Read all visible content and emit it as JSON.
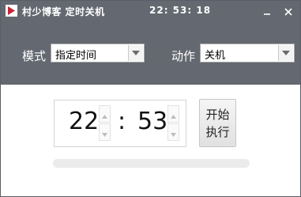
{
  "titlebar": {
    "title": "村少博客 定时关机",
    "clock": "22: 53: 18"
  },
  "options": {
    "mode_label": "模式",
    "mode_value": "指定时间",
    "action_label": "动作",
    "action_value": "关机"
  },
  "timer": {
    "hour": "22",
    "colon": ":",
    "minute": "53"
  },
  "start_button": {
    "line1": "开始",
    "line2": "执行"
  },
  "progress": {
    "fraction": 0
  },
  "colors": {
    "titlebar_bg": "#646870",
    "panel_bg": "#ffffff",
    "icon_accent": "#cc2233"
  }
}
